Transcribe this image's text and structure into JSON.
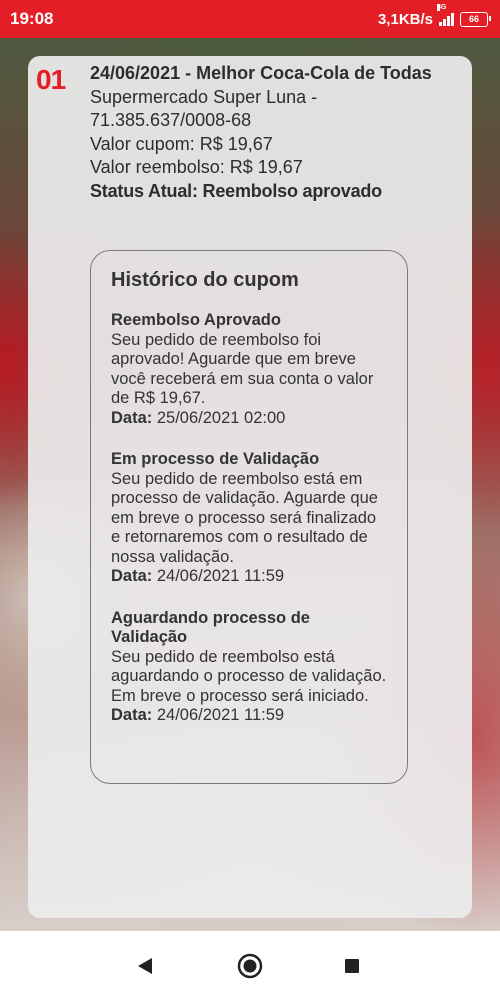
{
  "status_bar": {
    "time": "19:08",
    "speed": "3,1KB/s",
    "network": "4G",
    "battery": "66"
  },
  "coupon": {
    "number": "01",
    "title": "24/06/2021 - Melhor Coca-Cola de Todas",
    "store": "Supermercado Super Luna - 71.385.637/0008-68",
    "coupon_value": "Valor cupom: R$ 19,67",
    "refund_value": "Valor reembolso: R$ 19,67",
    "status": "Status Atual: Reembolso aprovado"
  },
  "history": {
    "heading": "Histórico do cupom",
    "date_label": "Data:",
    "entries": [
      {
        "title": "Reembolso Aprovado",
        "text": "Seu pedido de reembolso foi aprovado! Aguarde que em breve você receberá em sua conta o valor de R$ 19,67.",
        "date": "25/06/2021 02:00"
      },
      {
        "title": "Em processo de Validação",
        "text": "Seu pedido de reembolso está em processo de validação. Aguarde que em breve o processo será finalizado e retornaremos com o resultado de nossa validação.",
        "date": "24/06/2021 11:59"
      },
      {
        "title": "Aguardando processo de Validação",
        "text": "Seu pedido de reembolso está aguardando o processo de validação. Em breve o processo será iniciado.",
        "date": "24/06/2021 11:59"
      }
    ]
  },
  "navigation": {
    "back_icon": "back-triangle-icon",
    "home_icon": "home-circle-icon",
    "recents_icon": "recents-square-icon"
  },
  "colors": {
    "accent": "#e41e26",
    "text": "#2d2d2d"
  }
}
